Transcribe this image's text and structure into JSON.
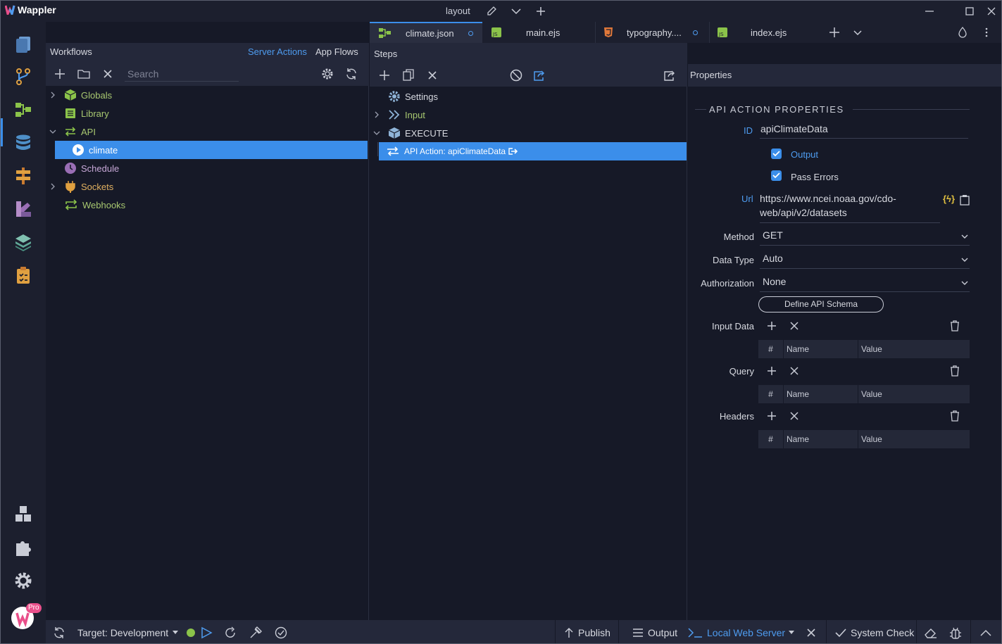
{
  "app": {
    "name": "Wappler",
    "document": "layout"
  },
  "tabs": [
    {
      "label": "climate.json",
      "icon": "flow-icon",
      "modified": true,
      "active": true
    },
    {
      "label": "main.ejs",
      "icon": "js-file-icon",
      "modified": false
    },
    {
      "label": "typography....",
      "icon": "css-file-icon",
      "modified": true
    },
    {
      "label": "index.ejs",
      "icon": "js-file-icon",
      "modified": false
    }
  ],
  "workflows": {
    "title": "Workflows",
    "server_actions": "Server Actions",
    "app_flows": "App Flows",
    "search_placeholder": "Search",
    "tree": [
      {
        "label": "Globals",
        "icon": "cube-icon",
        "color": "#8bc34a",
        "expandable": true
      },
      {
        "label": "Library",
        "icon": "library-icon",
        "color": "#8bc34a",
        "expandable": false
      },
      {
        "label": "API",
        "icon": "exchange-icon",
        "color": "#8bc34a",
        "expandable": true,
        "expanded": true
      },
      {
        "label": "climate",
        "icon": "play-circle-icon",
        "color": "#ffffff",
        "selected": true
      },
      {
        "label": "Schedule",
        "icon": "clock-icon",
        "color": "#b48cc8"
      },
      {
        "label": "Sockets",
        "icon": "plug-icon",
        "color": "#e0a040",
        "expandable": true
      },
      {
        "label": "Webhooks",
        "icon": "webhook-icon",
        "color": "#8bc34a"
      }
    ]
  },
  "steps": {
    "title": "Steps",
    "tree": [
      {
        "label": "Settings",
        "icon": "gear-icon"
      },
      {
        "label": "Input",
        "icon": "double-chevron-icon"
      },
      {
        "label": "EXECUTE",
        "icon": "cube-icon"
      },
      {
        "label": "API Action: apiClimateData",
        "icon": "exchange-icon",
        "selected": true
      }
    ]
  },
  "properties": {
    "title": "Properties",
    "section": "API ACTION PROPERTIES",
    "id_label": "ID",
    "id_value": "apiClimateData",
    "output_label": "Output",
    "pass_errors_label": "Pass Errors",
    "url_label": "Url",
    "url_value_1": "https://www.ncei.noaa.gov/cdo-",
    "url_value_2": "web/api/v2/datasets",
    "method_label": "Method",
    "method_value": "GET",
    "datatype_label": "Data Type",
    "datatype_value": "Auto",
    "auth_label": "Authorization",
    "auth_value": "None",
    "schema_button": "Define API Schema",
    "input_data_label": "Input Data",
    "query_label": "Query",
    "headers_label": "Headers",
    "col_hash": "#",
    "col_name": "Name",
    "col_value": "Value"
  },
  "statusbar": {
    "target": "Target: Development",
    "publish": "Publish",
    "output": "Output",
    "local_server": "Local Web Server",
    "system_check": "System Check",
    "server_status_color": "#8bc34a"
  },
  "badge": "Pro"
}
